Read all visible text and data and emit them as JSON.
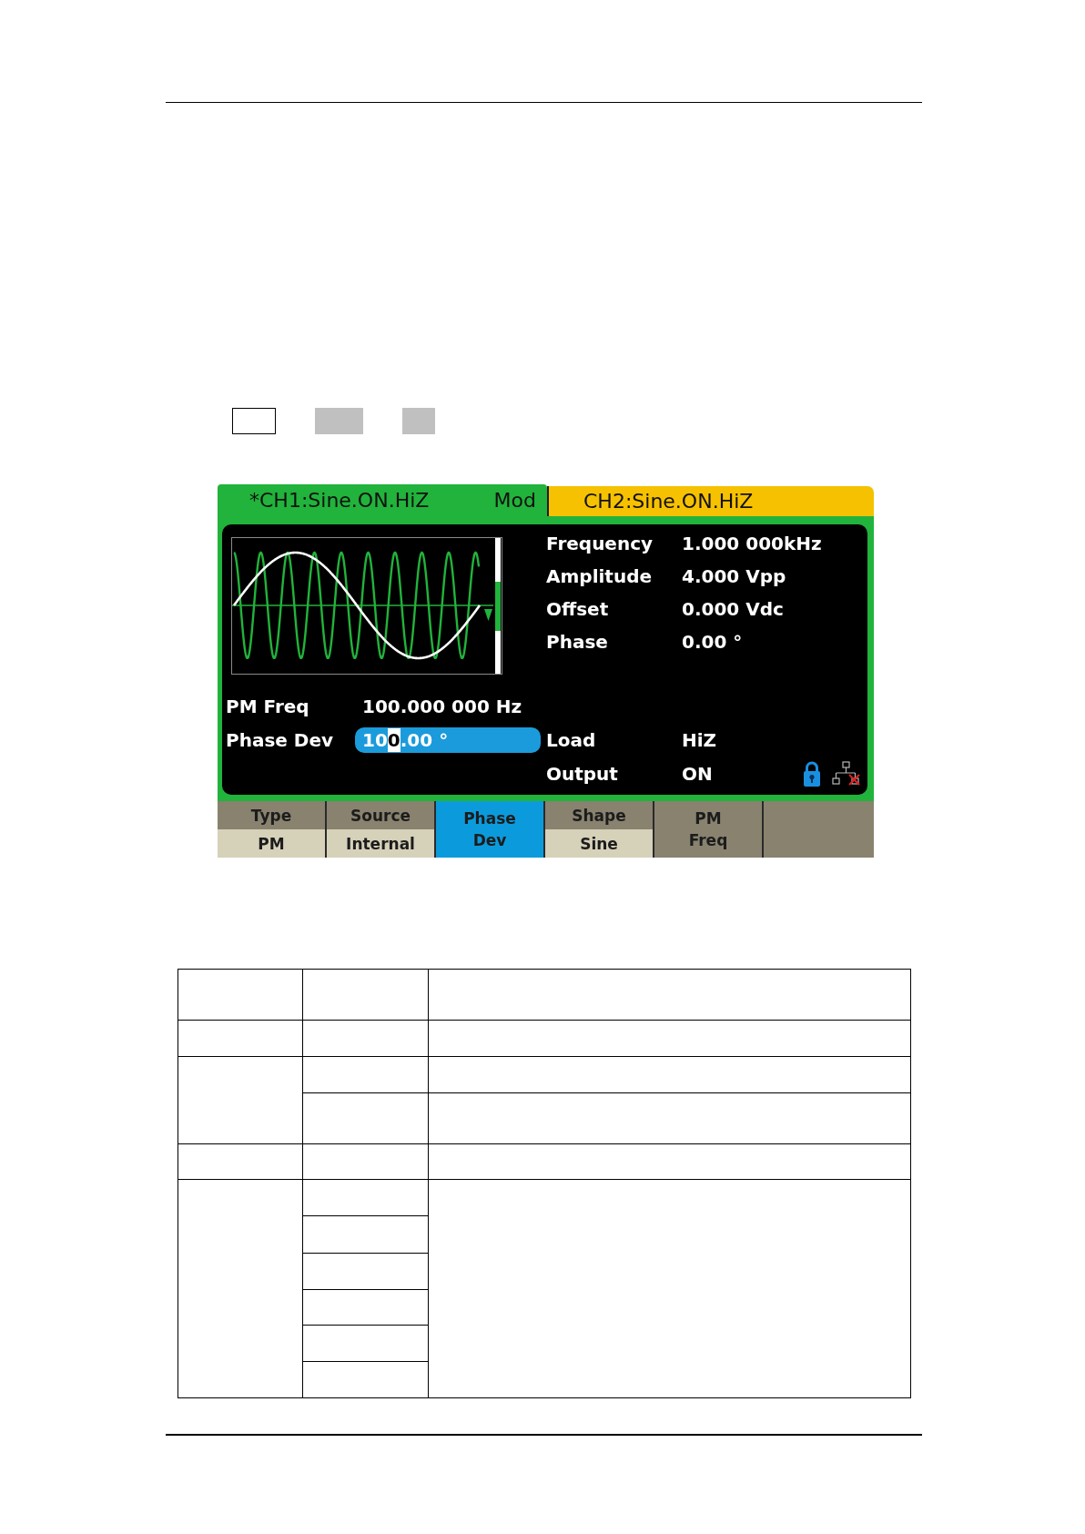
{
  "key_marks": [
    {
      "kind": "outlined"
    },
    {
      "kind": "shaded"
    },
    {
      "kind": "shaded"
    }
  ],
  "screen": {
    "channel_tabs": [
      {
        "label": "*CH1:Sine.ON.HiZ",
        "mode": "Mod",
        "color": "#21b33b",
        "selected": true
      },
      {
        "label": "CH2:Sine.ON.HiZ",
        "color": "#f6c100",
        "selected": false
      }
    ],
    "parameters": [
      {
        "label": "Frequency",
        "value": "1.000 000kHz"
      },
      {
        "label": "Amplitude",
        "value": "4.000 Vpp"
      },
      {
        "label": "Offset",
        "value": "0.000 Vdc"
      },
      {
        "label": "Phase",
        "value": "0.00 °"
      }
    ],
    "modulation": [
      {
        "label": "PM Freq",
        "editing": false,
        "value_parts": [
          {
            "text": "100.000 000 Hz",
            "cursor": false
          }
        ]
      },
      {
        "label": "Phase Dev",
        "editing": true,
        "value_parts": [
          {
            "text": "10",
            "cursor": false
          },
          {
            "text": "0",
            "cursor": true
          },
          {
            "text": ".00 °",
            "cursor": false
          }
        ]
      }
    ],
    "status": [
      {
        "label": "Load",
        "value": "HiZ"
      },
      {
        "label": "Output",
        "value": "ON"
      }
    ],
    "softkeys": [
      {
        "kind": "split",
        "label": "Type",
        "value": "PM",
        "selected": false
      },
      {
        "kind": "split",
        "label": "Source",
        "value": "Internal",
        "selected": false
      },
      {
        "kind": "stacked",
        "lines": [
          "Phase",
          "Dev"
        ],
        "selected": true
      },
      {
        "kind": "split",
        "label": "Shape",
        "value": "Sine",
        "selected": false
      },
      {
        "kind": "stacked",
        "lines": [
          "PM",
          "Freq"
        ],
        "selected": false
      }
    ]
  }
}
